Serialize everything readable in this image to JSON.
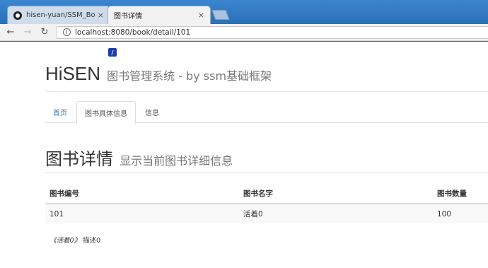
{
  "browser": {
    "tabs": [
      {
        "title": "hisen-yuan/SSM_Book",
        "close": "×"
      },
      {
        "title": "图书详情",
        "close": "×"
      }
    ],
    "url": "localhost:8080/book/detail/101"
  },
  "page": {
    "brand": "HiSEN",
    "brand_subtitle": "图书管理系统 - by ssm基础框架",
    "nav": [
      "首页",
      "图书具体信息",
      "信息"
    ],
    "heading": "图书详情",
    "heading_subtitle": "显示当前图书详细信息",
    "table": {
      "headers": [
        "图书编号",
        "图书名字",
        "图书数量"
      ],
      "row": [
        "101",
        "活着0",
        "100"
      ]
    },
    "desc_title": "《活着0》",
    "desc_text": "描述0"
  }
}
